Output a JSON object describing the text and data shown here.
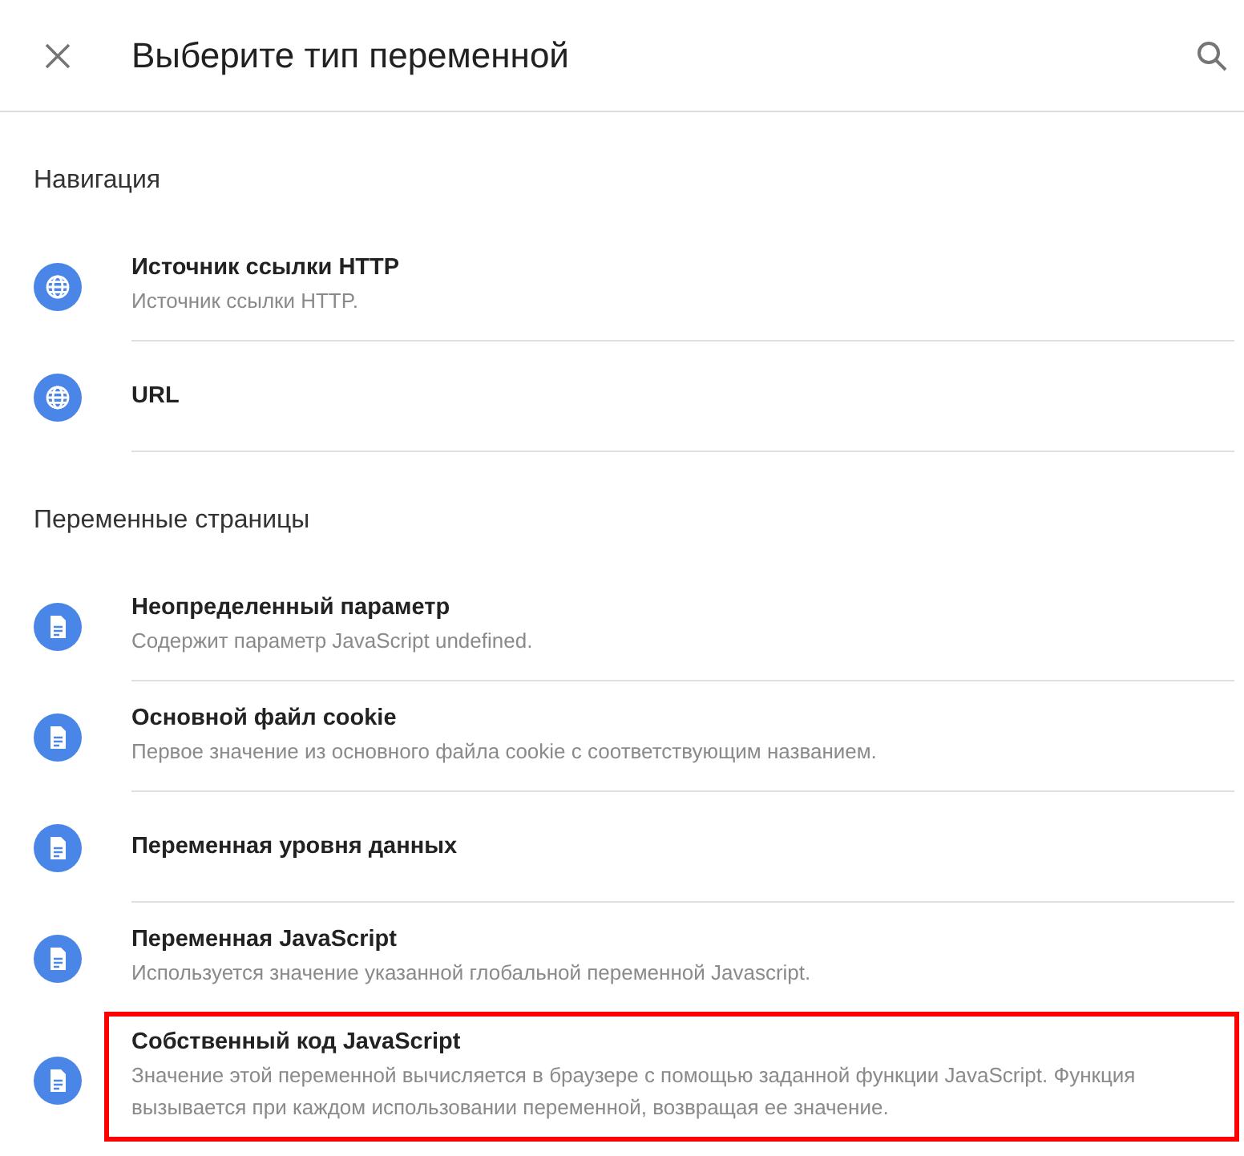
{
  "header": {
    "title": "Выберите тип переменной"
  },
  "sections": [
    {
      "heading": "Навигация",
      "items": [
        {
          "kind": "globe",
          "title": "Источник ссылки HTTP",
          "description": "Источник ссылки HTTP.",
          "highlighted": false
        },
        {
          "kind": "globe",
          "title": "URL",
          "highlighted": false
        }
      ]
    },
    {
      "heading": "Переменные страницы",
      "items": [
        {
          "kind": "document",
          "title": "Неопределенный параметр",
          "description": "Содержит параметр JavaScript undefined.",
          "highlighted": false
        },
        {
          "kind": "document",
          "title": "Основной файл cookie",
          "description": "Первое значение из основного файла cookie с соответствующим названием.",
          "highlighted": false
        },
        {
          "kind": "document",
          "title": "Переменная уровня данных",
          "highlighted": false
        },
        {
          "kind": "document",
          "title": "Переменная JavaScript",
          "description": "Используется значение указанной глобальной переменной Javascript.",
          "highlighted": false
        },
        {
          "kind": "document",
          "title": "Собственный код JavaScript",
          "description": "Значение этой переменной вычисляется в браузере с помощью заданной функции JavaScript. Функция вызывается при каждом использовании переменной, возвращая ее значение.",
          "highlighted": true
        }
      ]
    }
  ]
}
